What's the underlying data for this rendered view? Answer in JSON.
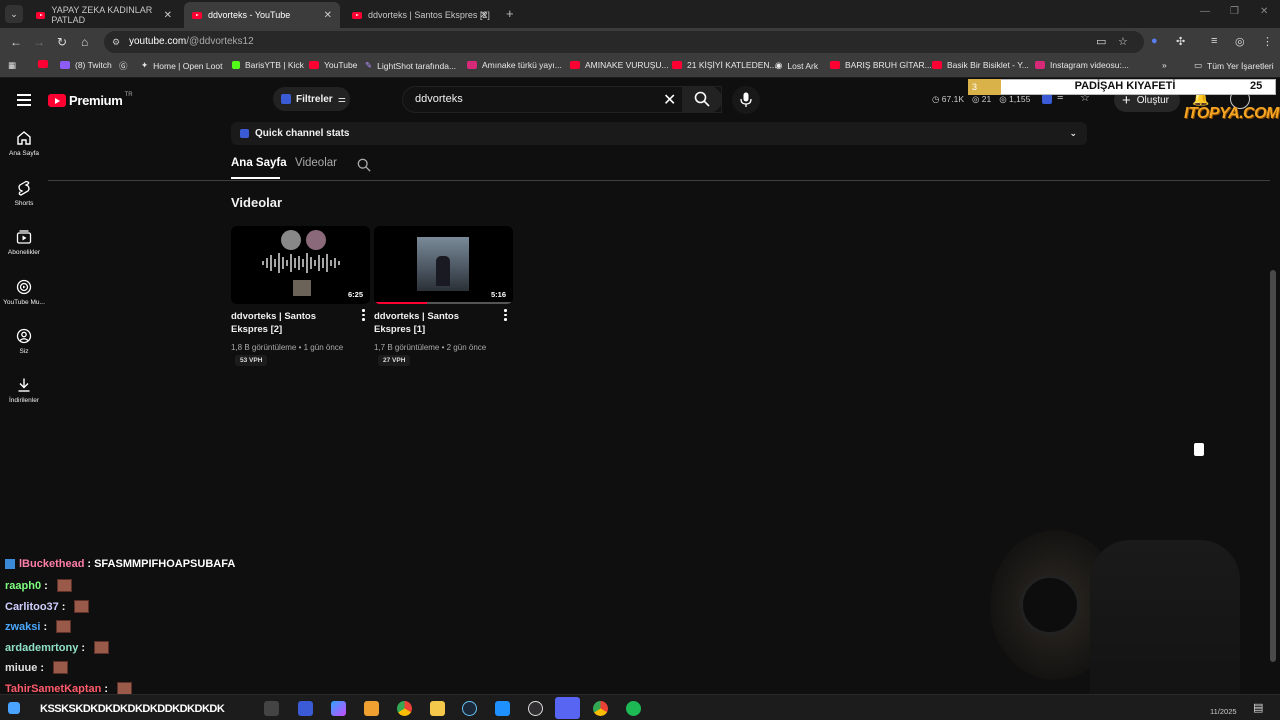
{
  "browser": {
    "tabs": [
      {
        "title": "YAPAY ZEKA KADINLAR PATLAD",
        "active": false
      },
      {
        "title": "ddvorteks - YouTube",
        "active": true
      },
      {
        "title": "ddvorteks | Santos Ekspres [2]",
        "active": false
      }
    ],
    "url_domain": "youtube.com",
    "url_path": "/@ddvorteks12",
    "bookmarks": [
      "(8) Twitch",
      "Home | Open Loot",
      "BarisYTB | Kick",
      "YouTube",
      "LightShot tarafında...",
      "Amınake türkü yayı...",
      "AMINAKE VURUŞU...",
      "21 KİŞİYİ KATLEDEN...",
      "Lost Ark",
      "BARIŞ BRUH GİTAR...",
      "Basik Bir Bisiklet - Y...",
      "Instagram videosu:..."
    ],
    "all_bookmarks": "Tüm Yer İşaretleri"
  },
  "youtube": {
    "logo_text": "Premium",
    "region": "TR",
    "filters_label": "Filtreler",
    "search_value": "ddvorteks",
    "header_stats": [
      "67.1K",
      "21",
      "1,155"
    ],
    "create_label": "Oluştur",
    "sidebar": [
      {
        "label": "Ana Sayfa",
        "icon": "home-icon"
      },
      {
        "label": "Shorts",
        "icon": "shorts-icon"
      },
      {
        "label": "Abonelikler",
        "icon": "subscriptions-icon"
      },
      {
        "label": "YouTube Mu...",
        "icon": "youtube-music-icon"
      },
      {
        "label": "Siz",
        "icon": "user-icon"
      },
      {
        "label": "İndirilenler",
        "icon": "download-icon"
      }
    ],
    "quick_stats_label": "Quick channel stats",
    "channel_tabs": [
      "Ana Sayfa",
      "Videolar"
    ],
    "section_title": "Videolar",
    "videos": [
      {
        "title": "ddvorteks | Santos Ekspres [2]",
        "duration": "6:25",
        "views": "1,8 B görüntüleme",
        "age": "1 gün önce",
        "vph": "53 VPH"
      },
      {
        "title": "ddvorteks | Santos Ekspres [1]",
        "duration": "5:16",
        "views": "1,7 B görüntüleme",
        "age": "2 gün önce",
        "vph": "27 VPH"
      }
    ]
  },
  "overlay": {
    "rank": "3",
    "title": "PADİŞAH KIYAFETİ",
    "count": "25",
    "logo": "ITOPYA.COM"
  },
  "chat": [
    {
      "user": "lBuckethead",
      "message": "SFASMMPIFHOAPSUBAFA",
      "color": "#ff7ea8"
    },
    {
      "user": "raaph0",
      "message": "",
      "color": "#7fff7f"
    },
    {
      "user": "Carlitoo37",
      "message": "",
      "color": "#cfcfff"
    },
    {
      "user": "zwaksi",
      "message": "",
      "color": "#4aa8ff"
    },
    {
      "user": "ardademrtony",
      "message": "",
      "color": "#8fe0c8"
    },
    {
      "user": "miuue",
      "message": "",
      "color": "#e0e0e0"
    },
    {
      "user": "TahirSametKaptan",
      "message": "",
      "color": "#ff5a6a"
    }
  ],
  "taskbar": {
    "spam_text": "KSSKSKDKDKDKDKDKDDKDKDKDK",
    "date": "11/2025"
  }
}
